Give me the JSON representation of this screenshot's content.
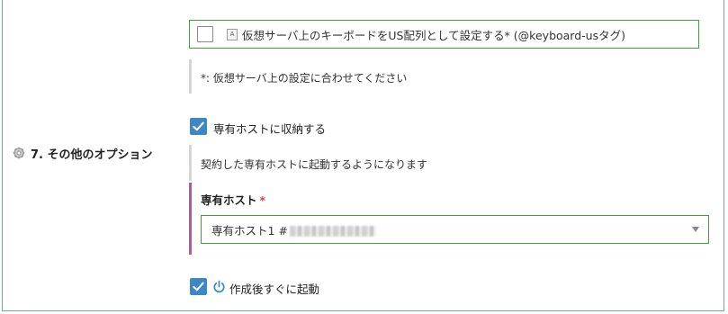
{
  "section": {
    "number_title": "7. その他のオプション",
    "icon": "gear-icon"
  },
  "keyboard_option": {
    "checked": false,
    "icon": "keyboard-icon",
    "icon_text": "A",
    "label": "仮想サーバ上のキーボードをUS配列として設定する* (@keyboard-usタグ)"
  },
  "keyboard_note": "*: 仮想サーバ上の設定に合わせてください",
  "dedicated_host_option": {
    "checked": true,
    "label": "専有ホストに収納する",
    "note": "契約した専有ホストに起動するようになります"
  },
  "dedicated_host_field": {
    "label": "専有ホスト",
    "required_mark": "*",
    "selected_value_prefix": "専有ホスト1 #"
  },
  "boot_option": {
    "checked": true,
    "icon": "power-icon",
    "label": "作成後すぐに起動"
  },
  "colors": {
    "accent_green": "#3aa535",
    "checkbox_blue": "#3d87c7",
    "required_red": "#e03b3b",
    "indicator_purple": "#a5609a"
  }
}
